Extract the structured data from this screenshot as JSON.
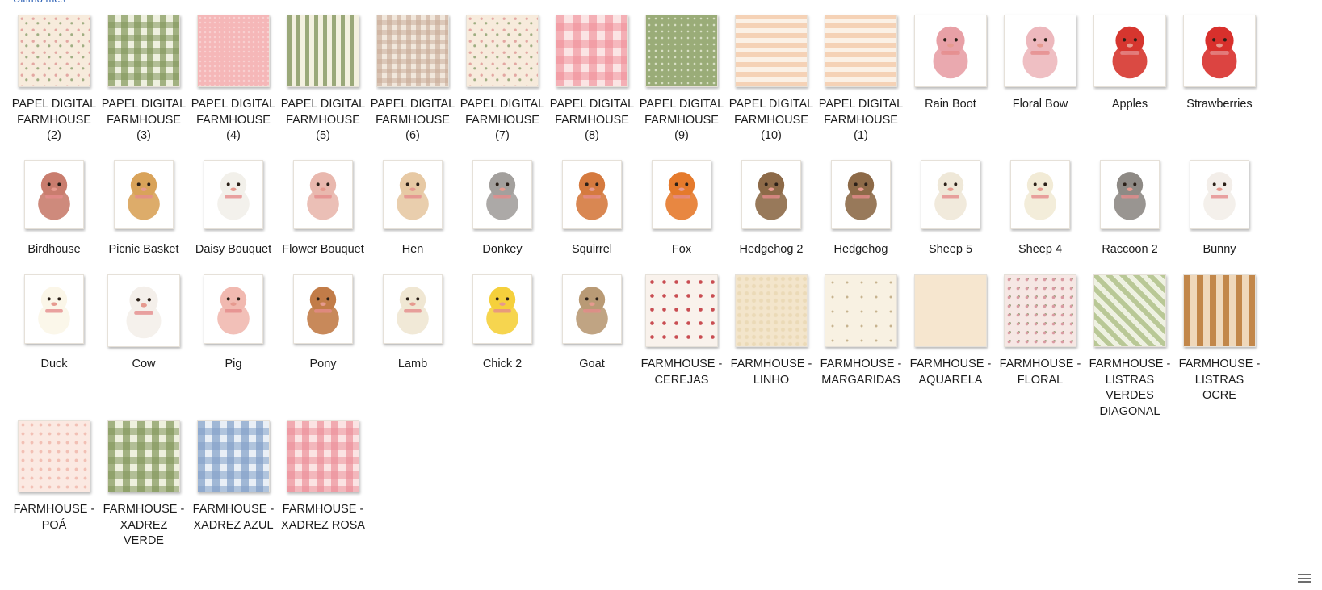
{
  "group": {
    "header": "Último mês"
  },
  "tiles": [
    {
      "label": "PAPEL DIGITAL FARMHOUSE (2)",
      "pattern": "p-floral-cream"
    },
    {
      "label": "PAPEL DIGITAL FARMHOUSE (3)",
      "pattern": "p-gingham-green"
    },
    {
      "label": "PAPEL DIGITAL FARMHOUSE (4)",
      "pattern": "p-pink-plain"
    },
    {
      "label": "PAPEL DIGITAL FARMHOUSE (5)",
      "pattern": "p-stripes-green"
    },
    {
      "label": "PAPEL DIGITAL FARMHOUSE (6)",
      "pattern": "p-gingham-beige"
    },
    {
      "label": "PAPEL DIGITAL FARMHOUSE (7)",
      "pattern": "p-floral-cream"
    },
    {
      "label": "PAPEL DIGITAL FARMHOUSE (8)",
      "pattern": "p-gingham-pink"
    },
    {
      "label": "PAPEL DIGITAL FARMHOUSE (9)",
      "pattern": "p-dots-green"
    },
    {
      "label": "PAPEL DIGITAL FARMHOUSE (10)",
      "pattern": "p-stripes-peach"
    },
    {
      "label": "PAPEL DIGITAL FARMHOUSE (1)",
      "pattern": "p-stripes-peach"
    },
    {
      "label": "Rain Boot",
      "icon": "rain-boot-icon",
      "color": "#e8a0a6"
    },
    {
      "label": "Floral Bow",
      "icon": "bow-icon",
      "color": "#edb8bd"
    },
    {
      "label": "Apples",
      "icon": "apple-icon",
      "color": "#d6362f"
    },
    {
      "label": "Strawberries",
      "icon": "strawberry-icon",
      "color": "#d8302c"
    },
    {
      "label": "Birdhouse",
      "icon": "birdhouse-icon",
      "color": "#c97d6e",
      "portrait": true
    },
    {
      "label": "Picnic Basket",
      "icon": "basket-icon",
      "color": "#d9a35a",
      "portrait": true
    },
    {
      "label": "Daisy Bouquet",
      "icon": "bouquet-icon",
      "color": "#f2f0ea",
      "portrait": true
    },
    {
      "label": "Flower Bouquet",
      "icon": "bouquet-icon",
      "color": "#e9b8ae",
      "portrait": true
    },
    {
      "label": "Hen",
      "icon": "hen-icon",
      "color": "#e7c9a4",
      "portrait": true
    },
    {
      "label": "Donkey",
      "icon": "donkey-icon",
      "color": "#a3a09d",
      "portrait": true
    },
    {
      "label": "Squirrel",
      "icon": "squirrel-icon",
      "color": "#d57a3f",
      "portrait": true
    },
    {
      "label": "Fox",
      "icon": "fox-icon",
      "color": "#e57a2c",
      "portrait": true
    },
    {
      "label": "Hedgehog 2",
      "icon": "hedgehog-icon",
      "color": "#8d6a48",
      "portrait": true
    },
    {
      "label": "Hedgehog",
      "icon": "hedgehog-icon",
      "color": "#8d6a48",
      "portrait": true
    },
    {
      "label": "Sheep 5",
      "icon": "sheep-icon",
      "color": "#efe8d8",
      "portrait": true
    },
    {
      "label": "Sheep 4",
      "icon": "sheep-icon",
      "color": "#f2ebd6",
      "portrait": true
    },
    {
      "label": "Raccoon 2",
      "icon": "raccoon-icon",
      "color": "#8e8a85",
      "portrait": true
    },
    {
      "label": "Bunny",
      "icon": "bunny-icon",
      "color": "#f3eee9",
      "portrait": true
    },
    {
      "label": "Duck",
      "icon": "duck-icon",
      "color": "#fbf6e8",
      "portrait": true
    },
    {
      "label": "Cow",
      "icon": "cow-icon",
      "color": "#f4efea"
    },
    {
      "label": "Pig",
      "icon": "pig-icon",
      "color": "#f1b9b0",
      "portrait": true
    },
    {
      "label": "Pony",
      "icon": "pony-icon",
      "color": "#c27c48",
      "portrait": true
    },
    {
      "label": "Lamb",
      "icon": "lamb-icon",
      "color": "#f0e7d3",
      "portrait": true
    },
    {
      "label": "Chick 2",
      "icon": "chick-icon",
      "color": "#f5d03c",
      "portrait": true
    },
    {
      "label": "Goat",
      "icon": "goat-icon",
      "color": "#b99a75",
      "portrait": true
    },
    {
      "label": "FARMHOUSE - CEREJAS",
      "pattern": "p-cherries"
    },
    {
      "label": "FARMHOUSE - LINHO",
      "pattern": "p-linen"
    },
    {
      "label": "FARMHOUSE - MARGARIDAS",
      "pattern": "p-daisies"
    },
    {
      "label": "FARMHOUSE - AQUARELA",
      "pattern": "p-watercolor"
    },
    {
      "label": "FARMHOUSE - FLORAL",
      "pattern": "p-floral-pink"
    },
    {
      "label": "FARMHOUSE - LISTRAS VERDES DIAGONAL",
      "pattern": "p-diag-green"
    },
    {
      "label": "FARMHOUSE - LISTRAS OCRE",
      "pattern": "p-stripes-ocre"
    },
    {
      "label": "FARMHOUSE - POÁ",
      "pattern": "p-poa"
    },
    {
      "label": "FARMHOUSE - XADREZ VERDE",
      "pattern": "p-xadrez-verde"
    },
    {
      "label": "FARMHOUSE - XADREZ AZUL",
      "pattern": "p-xadrez-azul"
    },
    {
      "label": "FARMHOUSE - XADREZ ROSA",
      "pattern": "p-xadrez-rosa"
    }
  ],
  "statusbar": {
    "view_icon": "details-view-icon"
  }
}
